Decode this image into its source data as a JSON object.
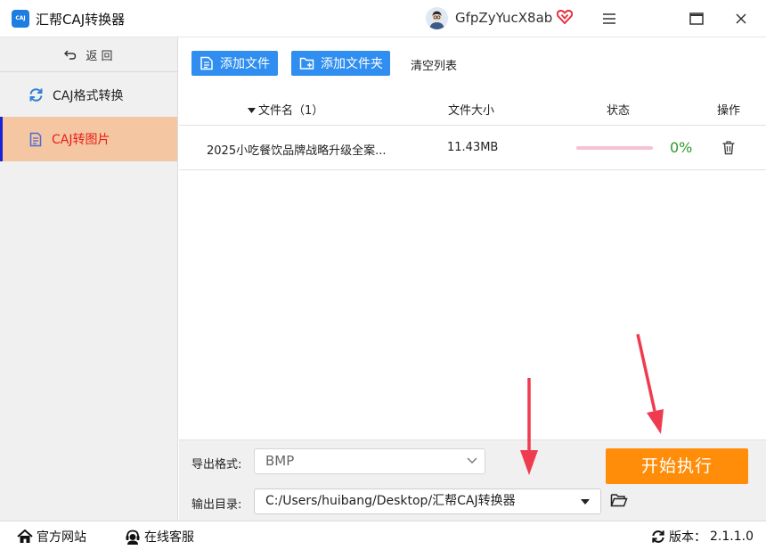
{
  "app": {
    "logo_text": "CAJ",
    "title": "汇帮CAJ转换器",
    "username": "GfpZyYucX8ab",
    "accent_color": "#2f8ef0",
    "start_color": "#ff8d0a",
    "icons": [
      "menu-icon",
      "maximize-icon",
      "close-icon",
      "vip-heart-icon",
      "avatar"
    ]
  },
  "sidebar": {
    "back_label": "返    回",
    "items": [
      {
        "label": "CAJ格式转换",
        "icon": "refresh-icon",
        "active": false
      },
      {
        "label": "CAJ转图片",
        "icon": "document-icon",
        "active": true
      }
    ]
  },
  "toolbar": {
    "add_file": "添加文件",
    "add_folder": "添加文件夹",
    "clear_list": "清空列表"
  },
  "table": {
    "columns": {
      "name": "文件名（1）",
      "size": "文件大小",
      "status": "状态",
      "action": "操作"
    },
    "rows": [
      {
        "name": "2025小吃餐饮品牌战略升级全案...",
        "size": "11.43MB",
        "progress_percent": 0,
        "progress_text": "0%"
      }
    ]
  },
  "settings": {
    "format_label": "导出格式:",
    "format_value": "BMP",
    "dir_label": "输出目录:",
    "dir_value": "C:/Users/huibang/Desktop/汇帮CAJ转换器",
    "start_label": "开始执行"
  },
  "footer": {
    "website": "官方网站",
    "service": "在线客服",
    "version_label": "版本：",
    "version_value": "2.1.1.0"
  }
}
